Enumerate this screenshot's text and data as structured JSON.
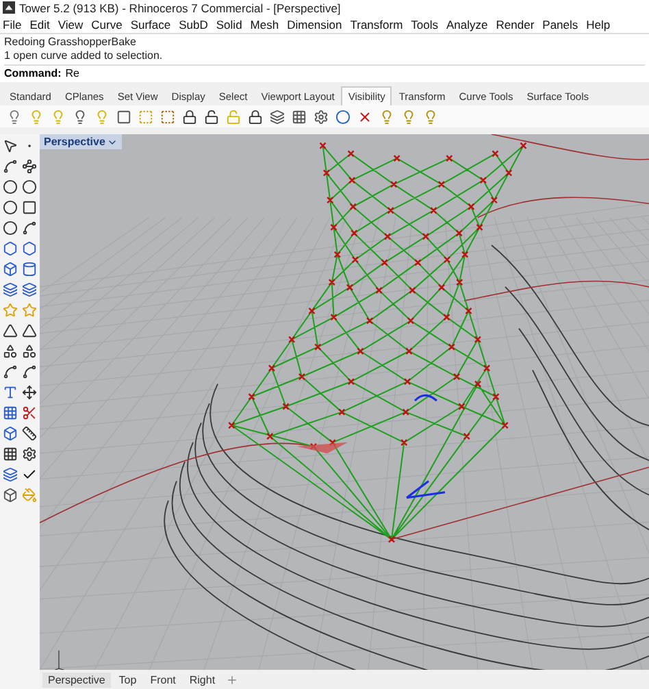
{
  "window": {
    "title": "Tower 5.2 (913 KB) - Rhinoceros 7 Commercial - [Perspective]"
  },
  "menu": [
    "File",
    "Edit",
    "View",
    "Curve",
    "Surface",
    "SubD",
    "Solid",
    "Mesh",
    "Dimension",
    "Transform",
    "Tools",
    "Analyze",
    "Render",
    "Panels",
    "Help"
  ],
  "command": {
    "history": [
      "Redoing GrasshopperBake",
      "1 open curve added to selection."
    ],
    "prompt": "Command:",
    "value": "Re"
  },
  "toolbar_tabs": [
    {
      "label": "Standard",
      "selected": false
    },
    {
      "label": "CPlanes",
      "selected": false
    },
    {
      "label": "Set View",
      "selected": false
    },
    {
      "label": "Display",
      "selected": false
    },
    {
      "label": "Select",
      "selected": false
    },
    {
      "label": "Viewport Layout",
      "selected": false
    },
    {
      "label": "Visibility",
      "selected": true
    },
    {
      "label": "Transform",
      "selected": false
    },
    {
      "label": "Curve Tools",
      "selected": false
    },
    {
      "label": "Surface Tools",
      "selected": false
    }
  ],
  "viewport": {
    "label": "Perspective"
  },
  "viewport_tabs": [
    {
      "label": "Perspective",
      "selected": true
    },
    {
      "label": "Top",
      "selected": false
    },
    {
      "label": "Front",
      "selected": false
    },
    {
      "label": "Right",
      "selected": false
    }
  ]
}
